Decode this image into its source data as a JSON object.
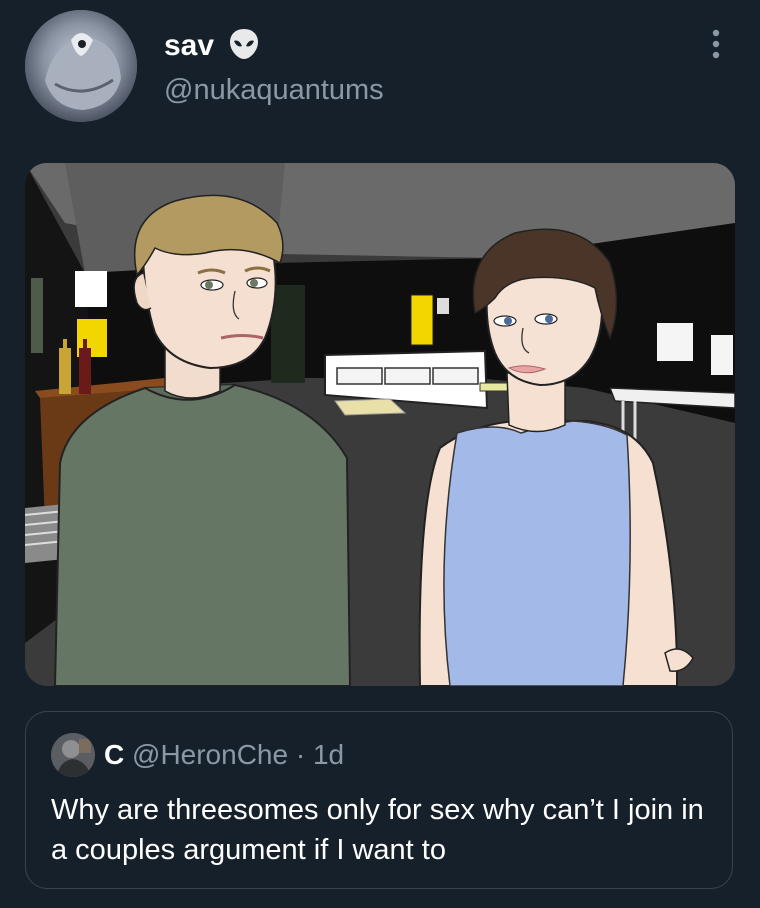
{
  "author": {
    "display_name": "sav",
    "badge_icon": "alien-icon",
    "handle": "@nukaquantums"
  },
  "menu_icon": "more-options-icon",
  "media": {
    "alt": "cartoon illustration of a man and a woman standing in a room"
  },
  "quoted_tweet": {
    "name": "C",
    "handle": "@HeronChe",
    "separator": "·",
    "time": "1d",
    "text": "Why are threesomes only for sex why can’t I join in a couples argument if I want to"
  },
  "colors": {
    "background": "#15202b",
    "secondary_text": "#8b98a5",
    "border": "#38444d"
  }
}
